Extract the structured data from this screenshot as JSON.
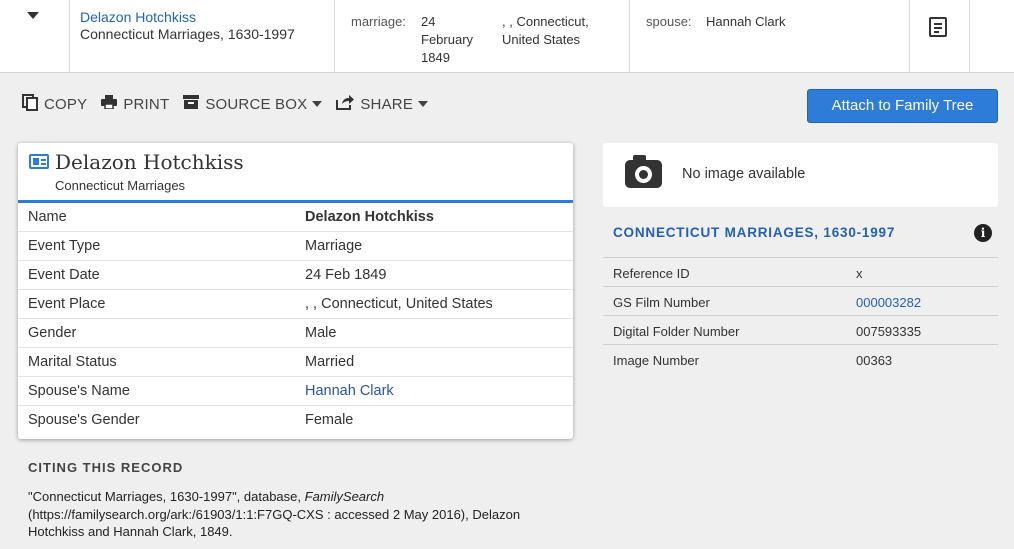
{
  "result_row": {
    "name": "Delazon Hotchkiss",
    "collection": "Connecticut Marriages, 1630-1997",
    "event_label": "marriage:",
    "event_date_lines": [
      "24",
      "February",
      "1849"
    ],
    "event_place_lines": [
      ", , Connecticut,",
      "United States"
    ],
    "spouse_label": "spouse:",
    "spouse_name": "Hannah Clark",
    "note_icon": "notes-icon"
  },
  "toolbar": {
    "copy_label": "COPY",
    "print_label": "PRINT",
    "source_box_label": "SOURCE BOX",
    "share_label": "SHARE",
    "attach_label": "Attach to Family Tree"
  },
  "record": {
    "title": "Delazon Hotchkiss",
    "subtitle": "Connecticut Marriages",
    "rows": [
      {
        "key": "Name",
        "value": "Delazon Hotchkiss"
      },
      {
        "key": "Event Type",
        "value": "Marriage"
      },
      {
        "key": "Event Date",
        "value": "24 Feb 1849"
      },
      {
        "key": "Event Place",
        "value": ", , Connecticut, United States"
      },
      {
        "key": "Gender",
        "value": "Male"
      },
      {
        "key": "Marital Status",
        "value": "Married"
      },
      {
        "key": "Spouse's Name",
        "value": "Hannah Clark"
      },
      {
        "key": "Spouse's Gender",
        "value": "Female"
      }
    ]
  },
  "citation": {
    "heading": "CITING THIS RECORD",
    "text_prefix": "\"Connecticut Marriages, 1630-1997\", database, ",
    "text_italic": "FamilySearch",
    "text_suffix": " (https://familysearch.org/ark:/61903/1:1:F7GQ-CXS : accessed 2 May 2016), Delazon Hotchkiss and Hannah Clark, 1849."
  },
  "image_panel": {
    "message": "No image available"
  },
  "source": {
    "title": "CONNECTICUT MARRIAGES, 1630-1997",
    "rows": [
      {
        "key": "Reference ID",
        "value": "x"
      },
      {
        "key": "GS Film Number",
        "value": "000003282"
      },
      {
        "key": "Digital Folder Number",
        "value": "007593335"
      },
      {
        "key": "Image Number",
        "value": "00363"
      }
    ]
  },
  "colors": {
    "accent": "#2c7cd8",
    "link": "#2360b4"
  }
}
